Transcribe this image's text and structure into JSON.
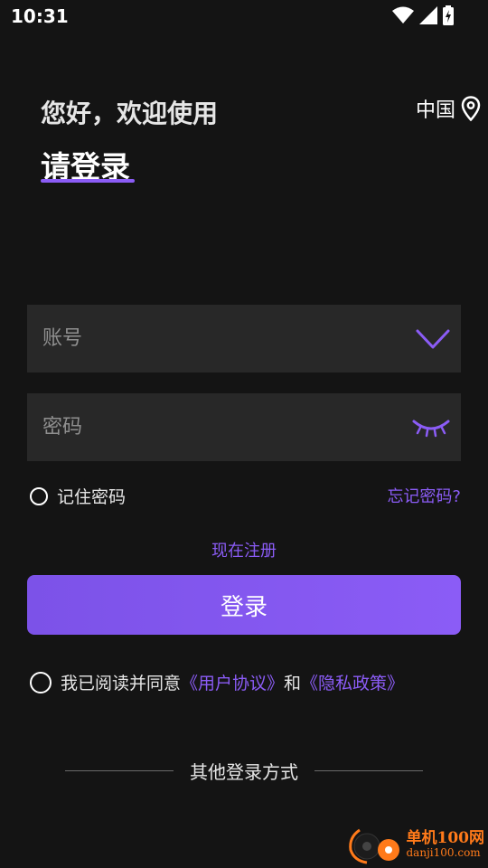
{
  "status_bar": {
    "time": "10:31",
    "icons": [
      "wifi-icon",
      "signal-icon",
      "battery-charging-icon"
    ]
  },
  "header": {
    "welcome": "您好，欢迎使用",
    "login_heading": "请登录",
    "region": "中国",
    "region_icon": "location-pin-icon"
  },
  "form": {
    "account_placeholder": "账号",
    "account_icon": "chevron-down-icon",
    "password_placeholder": "密码",
    "password_icon": "eye-closed-icon",
    "remember_label": "记住密码",
    "forgot_label": "忘记密码?",
    "register_label": "现在注册",
    "login_button": "登录"
  },
  "agreement": {
    "prefix": "我已阅读并同意",
    "user_agreement": "《用户协议》",
    "conjunction": "和",
    "privacy_policy": "《隐私政策》"
  },
  "other_login": {
    "label": "其他登录方式"
  },
  "watermark": {
    "name": "单机100网",
    "domain": "danji100.com"
  },
  "colors": {
    "background": "#141414",
    "field": "#282828",
    "accent": "#8b5cf6",
    "watermark": "#ff7a1a"
  }
}
